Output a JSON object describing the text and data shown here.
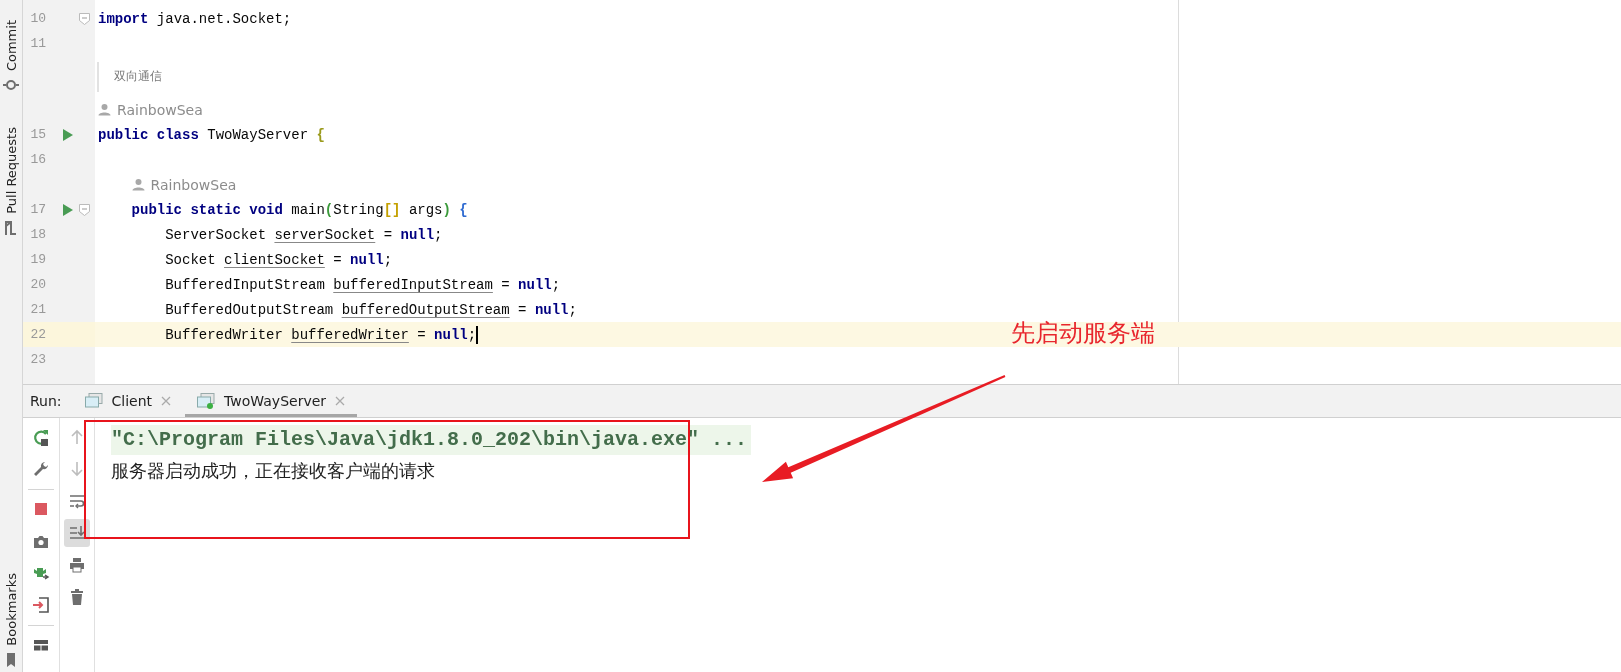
{
  "tool_windows": [
    {
      "label": "Commit",
      "kind": "top"
    },
    {
      "label": "Pull Requests",
      "kind": "top"
    },
    {
      "label": "Bookmarks",
      "kind": "bottom"
    }
  ],
  "editor": {
    "lines": [
      {
        "kind": "code",
        "number": "10",
        "run": false,
        "fold": true,
        "current": false,
        "tokens": [
          {
            "text": "import",
            "kind": "keyword"
          },
          {
            "text": " java.net.Socket;",
            "kind": "plain"
          }
        ]
      },
      {
        "kind": "code",
        "number": "11",
        "run": false,
        "fold": false,
        "current": false
      },
      {
        "kind": "doc",
        "text": "双向通信"
      },
      {
        "kind": "author",
        "text": "RainbowSea"
      },
      {
        "kind": "code",
        "number": "15",
        "run": true,
        "fold": false,
        "current": false,
        "tokens": [
          {
            "text": "public class",
            "kind": "keyword"
          },
          {
            "text": " TwoWayServer ",
            "kind": "plain"
          },
          {
            "text": "{",
            "kind": "bracket",
            "color": "#9a9a1c"
          }
        ]
      },
      {
        "kind": "code",
        "number": "16",
        "run": false,
        "fold": false,
        "current": false
      },
      {
        "kind": "author",
        "text": "RainbowSea"
      },
      {
        "kind": "code",
        "number": "17",
        "run": true,
        "fold": true,
        "current": false,
        "tokens": [
          {
            "text": "    public static void",
            "kind": "keyword"
          },
          {
            "text": " main",
            "kind": "plain"
          },
          {
            "text": "(",
            "kind": "bracket",
            "color": "#3a9a3a"
          },
          {
            "text": "String",
            "kind": "plain"
          },
          {
            "text": "[]",
            "kind": "bracket",
            "color": "#c4a000"
          },
          {
            "text": " args",
            "kind": "plain"
          },
          {
            "text": ")",
            "kind": "bracket",
            "color": "#3a9a3a"
          },
          {
            "text": " {",
            "kind": "bracket",
            "color": "#2f6bd1"
          }
        ]
      },
      {
        "kind": "code",
        "number": "18",
        "run": false,
        "fold": false,
        "current": false,
        "tokens": [
          {
            "text": "        ServerSocket ",
            "kind": "plain"
          },
          {
            "text": "serverSocket",
            "kind": "variable"
          },
          {
            "text": " = ",
            "kind": "plain"
          },
          {
            "text": "null",
            "kind": "keyword"
          },
          {
            "text": ";",
            "kind": "plain"
          }
        ]
      },
      {
        "kind": "code",
        "number": "19",
        "run": false,
        "fold": false,
        "current": false,
        "tokens": [
          {
            "text": "        Socket ",
            "kind": "plain"
          },
          {
            "text": "clientSocket",
            "kind": "variable"
          },
          {
            "text": " = ",
            "kind": "plain"
          },
          {
            "text": "null",
            "kind": "keyword"
          },
          {
            "text": ";",
            "kind": "plain"
          }
        ]
      },
      {
        "kind": "code",
        "number": "20",
        "run": false,
        "fold": false,
        "current": false,
        "tokens": [
          {
            "text": "        BufferedInputStream ",
            "kind": "plain"
          },
          {
            "text": "bufferedInputStream",
            "kind": "variable"
          },
          {
            "text": " = ",
            "kind": "plain"
          },
          {
            "text": "null",
            "kind": "keyword"
          },
          {
            "text": ";",
            "kind": "plain"
          }
        ]
      },
      {
        "kind": "code",
        "number": "21",
        "run": false,
        "fold": false,
        "current": false,
        "tokens": [
          {
            "text": "        BufferedOutputStream ",
            "kind": "plain"
          },
          {
            "text": "bufferedOutputStream",
            "kind": "variable"
          },
          {
            "text": " = ",
            "kind": "plain"
          },
          {
            "text": "null",
            "kind": "keyword"
          },
          {
            "text": ";",
            "kind": "plain"
          }
        ]
      },
      {
        "kind": "code",
        "number": "22",
        "run": false,
        "fold": false,
        "current": true,
        "tokens": [
          {
            "text": "        BufferedWriter ",
            "kind": "plain"
          },
          {
            "text": "bufferedWriter",
            "kind": "variable"
          },
          {
            "text": " = ",
            "kind": "plain"
          },
          {
            "text": "null",
            "kind": "keyword"
          },
          {
            "text": ";",
            "kind": "plain"
          }
        ]
      },
      {
        "kind": "code",
        "number": "23",
        "run": false,
        "fold": false,
        "current": false
      }
    ]
  },
  "run_panel": {
    "label": "Run:",
    "tabs": [
      {
        "label": "Client",
        "selected": false,
        "running": false
      },
      {
        "label": "TwoWayServer",
        "selected": true,
        "running": true
      }
    ],
    "console": [
      {
        "kind": "command",
        "text": "\"C:\\Program Files\\Java\\jdk1.8.0_202\\bin\\java.exe\" ..."
      },
      {
        "kind": "output",
        "text": "服务器启动成功，正在接收客户端的请求"
      }
    ]
  },
  "annotation": {
    "text": "先启动服务端"
  }
}
